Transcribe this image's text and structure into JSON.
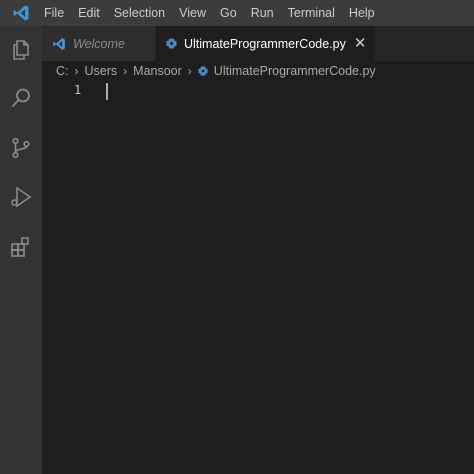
{
  "app": {
    "logo_icon": "vscode-logo-icon",
    "accent": "#3c99dc"
  },
  "menu": {
    "items": [
      "File",
      "Edit",
      "Selection",
      "View",
      "Go",
      "Run",
      "Terminal",
      "Help"
    ]
  },
  "activitybar": {
    "icons": [
      "explorer-icon",
      "search-icon",
      "source-control-icon",
      "run-debug-icon",
      "extensions-icon"
    ]
  },
  "tabs": [
    {
      "label": "Welcome",
      "icon": "vscode-icon",
      "active": false
    },
    {
      "label": "UltimateProgrammerCode.py",
      "icon": "python-file-icon",
      "active": true,
      "close": "✕"
    }
  ],
  "breadcrumb": {
    "parts": [
      "C:",
      "Users",
      "Mansoor",
      "UltimateProgrammerCode.py"
    ],
    "separator": "›"
  },
  "editor": {
    "line_numbers": [
      "1"
    ]
  }
}
